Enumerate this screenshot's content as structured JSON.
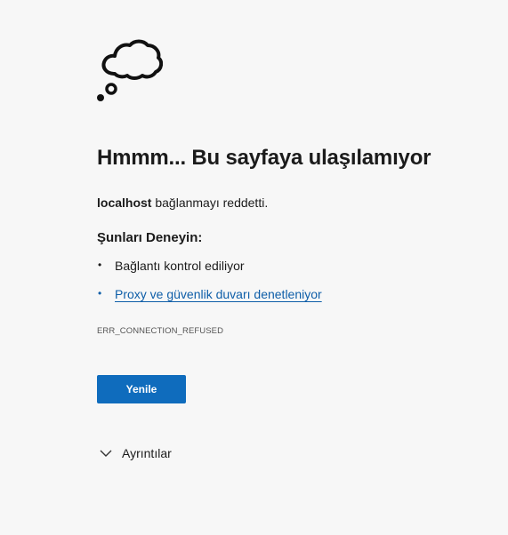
{
  "error": {
    "title": "Hmmm... Bu sayfaya ulaşılamıyor",
    "host": "localhost",
    "host_message": " bağlanmayı reddetti.",
    "try_heading": "Şunları Deneyin:",
    "suggestions": [
      {
        "label": "Bağlantı kontrol ediliyor",
        "is_link": false
      },
      {
        "label": "Proxy ve güvenlik duvarı denetleniyor",
        "is_link": true
      }
    ],
    "code": "ERR_CONNECTION_REFUSED",
    "reload_label": "Yenile",
    "details_label": "Ayrıntılar"
  },
  "icons": {
    "illustration": "thought-cloud-icon",
    "details_toggle": "chevron-down-icon"
  },
  "colors": {
    "background": "#f7f7f7",
    "accent": "#0f6cbd",
    "link": "#0e5ea8",
    "text": "#1b1b1b"
  }
}
